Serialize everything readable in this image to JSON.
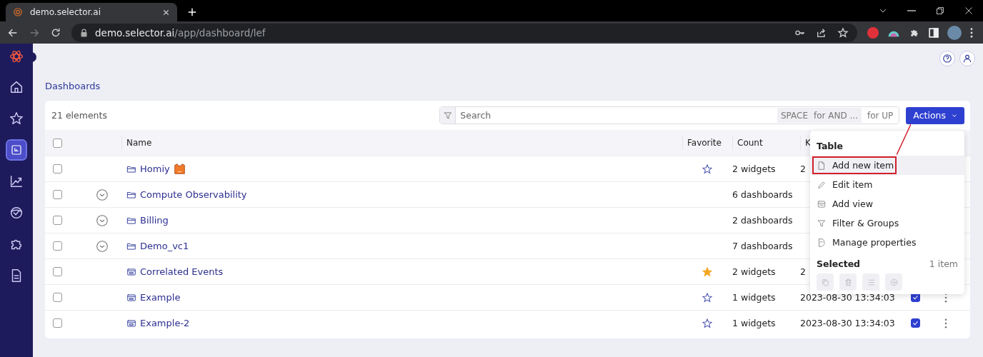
{
  "browser": {
    "tab": {
      "title": "demo.selector.ai"
    },
    "url": {
      "host": "demo.selector.ai",
      "path": "/app/dashboard/lef"
    }
  },
  "sidebar": {
    "items": [
      {
        "selected": false
      },
      {
        "selected": false
      },
      {
        "selected": true
      },
      {
        "selected": false
      },
      {
        "selected": false
      },
      {
        "selected": false
      },
      {
        "selected": false
      }
    ]
  },
  "breadcrumb": "Dashboards",
  "toolbar": {
    "count": "21 elements",
    "search": {
      "placeholder": "Search"
    },
    "hint_key": "SPACE",
    "hint_key_text": "for AND ...",
    "hint_text": "for UP",
    "actions_button": "Actions"
  },
  "table": {
    "all_selected": false,
    "columns": [
      {
        "label": "Name"
      },
      {
        "label": "Favorite"
      },
      {
        "label": "Count"
      },
      {
        "label": "K"
      }
    ],
    "rows": [
      {
        "name": "Homiy",
        "kind": "folder",
        "emoji": true,
        "selected": false,
        "favorite": false,
        "count": "2 widgets",
        "column_4": "2"
      },
      {
        "name": "Compute Observability",
        "kind": "folder",
        "selected": false,
        "expandable": true,
        "count": "6 dashboards"
      },
      {
        "name": "Billing",
        "kind": "folder",
        "selected": false,
        "expandable": true,
        "count": "2 dashboards"
      },
      {
        "name": "Demo_vc1",
        "kind": "folder",
        "selected": false,
        "expandable": true,
        "count": "7 dashboards"
      },
      {
        "name": "Correlated Events",
        "kind": "dashboard",
        "selected": false,
        "favorite": true,
        "count": "2 widgets",
        "column_4": "2"
      },
      {
        "name": "Example",
        "kind": "dashboard",
        "selected": false,
        "favorite": false,
        "count": "1 widgets",
        "column_4": "2023-08-30 13:34:03",
        "checked": true
      },
      {
        "name": "Example-2",
        "kind": "dashboard",
        "selected": false,
        "favorite": false,
        "count": "1 widgets",
        "column_4": "2023-08-30 13:34:03",
        "checked": true
      }
    ]
  },
  "menu": {
    "title": "Table",
    "items": [
      {
        "label": "Add new item",
        "hovered": true,
        "highlighted": true
      },
      {
        "label": "Edit item",
        "hovered": false,
        "highlighted": false
      },
      {
        "label": "Add view",
        "hovered": false,
        "highlighted": false
      },
      {
        "label": "Filter & Groups",
        "hovered": false,
        "highlighted": false
      },
      {
        "label": "Manage properties",
        "hovered": false,
        "highlighted": false
      }
    ],
    "selected_title": "Selected",
    "selected_count": "1 item",
    "tools": [
      {
        "disabled": true
      },
      {
        "disabled": true
      },
      {
        "disabled": true
      },
      {
        "disabled": true
      }
    ]
  }
}
